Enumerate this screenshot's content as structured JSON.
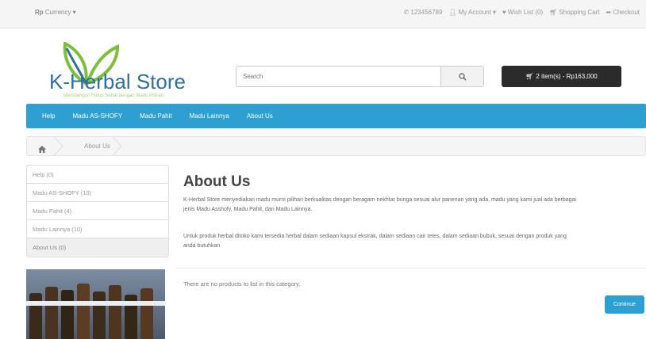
{
  "topbar": {
    "currency_symbol": "Rp",
    "currency_label": "Currency",
    "phone": "123456789",
    "my_account": "My Account",
    "wishlist": "Wish List (0)",
    "shopping_cart": "Shopping Cart",
    "checkout": "Checkout"
  },
  "header": {
    "logo_text": "K-Herbal Store",
    "logo_tagline": "Membangun Hidup Sehat dengan Madu Pilihan",
    "search_placeholder": "Search",
    "cart_label": "2 item(s) - Rp163,000"
  },
  "nav": {
    "items": [
      "Help",
      "Madu AS-SHOFY",
      "Madu Pahit",
      "Madu Lainnya",
      "About Us"
    ]
  },
  "breadcrumb": {
    "current": "About Us"
  },
  "sidebar": {
    "categories": [
      "Help (0)",
      "Madu AS-SHOFY (10)",
      "Madu Pahit (4)",
      "Madu Lainnya (10)",
      "About Us (0)"
    ]
  },
  "content": {
    "title": "About Us",
    "paragraph1": "K-Herbal Store menyediakan madu murni pilihan berkualitas dengan beragam nekhtar bunga sesuai alur panenan yang ada, madu yang kami jual ada berbagai jenis Madu Asshofy, Madu Pahit, dan Madu Lainnya.",
    "paragraph2": "Untuk produk herbal ditoko kami tersedia herbal dalam sediaan kapsul ekstrak, dalam sediaan cair tetes, dalam sediaan bubuk, sesuai dengan produk yang anda butuhkan",
    "empty_message": "There are no products to list in this category.",
    "continue_label": "Continue"
  },
  "colors": {
    "accent": "#2d9fd0",
    "logo_blue": "#2e6f9e",
    "logo_green": "#7bbf3a",
    "cart_bg": "#2b2b2b"
  }
}
